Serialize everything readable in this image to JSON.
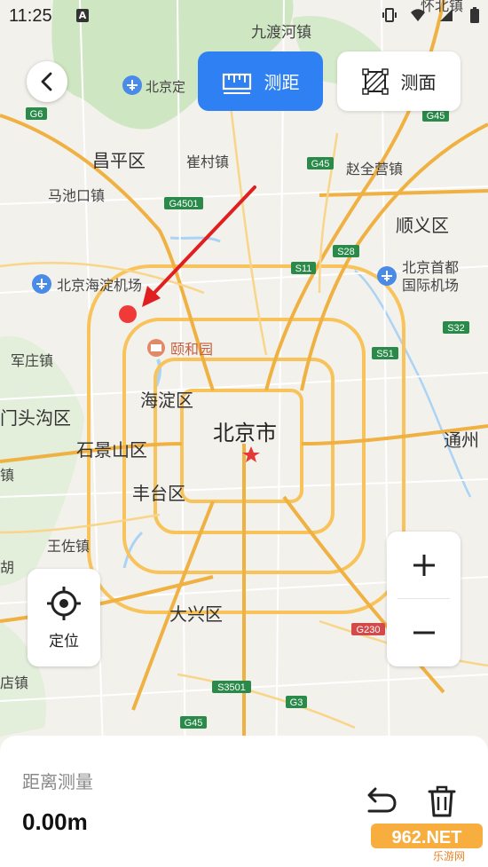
{
  "status_bar": {
    "time": "11:25",
    "notification_letter": "A",
    "top_right_label": "怀北镇"
  },
  "header": {
    "mode_distance_label": "测距",
    "mode_area_label": "测面"
  },
  "map": {
    "labels": {
      "jiuduhe": "九渡河镇",
      "beijing_airport_north": "北京定",
      "changping": "昌平区",
      "cuicun": "崔村镇",
      "zhaoquanying": "赵全营镇",
      "machikou": "马池口镇",
      "shunyi": "顺义区",
      "haidian_airport": "北京海淀机场",
      "capital_airport_1": "北京首都",
      "capital_airport_2": "国际机场",
      "yiheyuan": "颐和园",
      "junzhuang": "军庄镇",
      "haidian": "海淀区",
      "mentougou": "门头沟区",
      "beijing_city": "北京市",
      "shijingshan": "石景山区",
      "tongzhou": "通州",
      "fengtai": "丰台区",
      "wangzuo": "王佐镇",
      "hu": "胡",
      "daxing": "大兴区",
      "dian": "店镇",
      "zhen_left": "镇"
    },
    "road_shields": {
      "g6": "G6",
      "g45_top": "G45",
      "g45_mid": "G45",
      "g4501": "G4501",
      "s11": "S11",
      "s28": "S28",
      "s32": "S32",
      "s51": "S51",
      "g230": "G230",
      "s3501": "S3501",
      "g3": "G3",
      "g45_bottom": "G45"
    }
  },
  "controls": {
    "locate_label": "定位",
    "zoom_in_symbol": "+",
    "zoom_out_symbol": "−"
  },
  "panel": {
    "title": "距离测量",
    "value": "0.00m"
  },
  "watermark": {
    "brand": "962.NET",
    "sub": "乐游网"
  },
  "colors": {
    "accent": "#2f80f2",
    "marker": "#f03a3a",
    "arrow": "#e02020",
    "road_main": "#f7c35a",
    "green": "#cfe6c2",
    "water": "#aad3f5"
  },
  "icons": {
    "back": "chevron-left-icon",
    "distance": "ruler-icon",
    "area": "polygon-icon",
    "locate": "crosshair-icon",
    "undo": "undo-icon",
    "delete": "trash-icon"
  }
}
